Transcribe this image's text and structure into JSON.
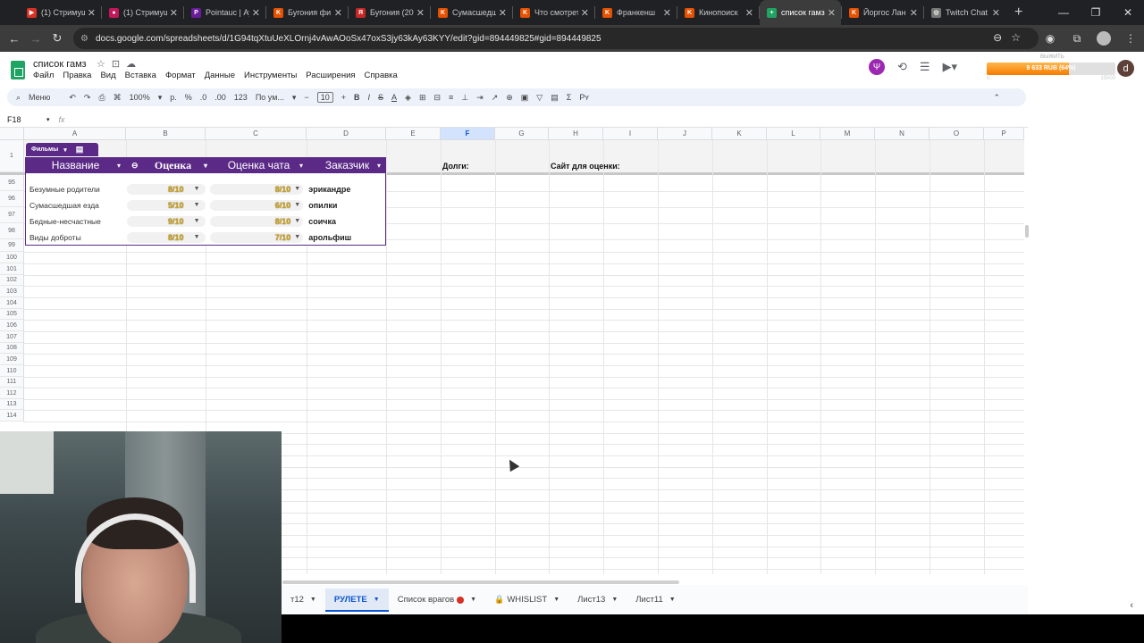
{
  "browser": {
    "tabs": [
      {
        "title": "(1) Стримуш",
        "fav_color": "#d93025",
        "fav": "▶",
        "active": false
      },
      {
        "title": "(1) Стримуш",
        "fav_color": "#c2185b",
        "fav": "●",
        "active": false
      },
      {
        "title": "Pointauc | Ау",
        "fav_color": "#6a1b9a",
        "fav": "P",
        "active": false
      },
      {
        "title": "Бугония фи",
        "fav_color": "#e65100",
        "fav": "K",
        "active": false
      },
      {
        "title": "Бугония (20",
        "fav_color": "#c62828",
        "fav": "Я",
        "active": false
      },
      {
        "title": "Сумасшедш",
        "fav_color": "#e65100",
        "fav": "K",
        "active": false
      },
      {
        "title": "Что смотрет",
        "fav_color": "#e65100",
        "fav": "K",
        "active": false
      },
      {
        "title": "Франкенш",
        "fav_color": "#e65100",
        "fav": "K",
        "active": false
      },
      {
        "title": "Кинопоиск",
        "fav_color": "#e65100",
        "fav": "K",
        "active": false
      },
      {
        "title": "список гамз",
        "fav_color": "#1fa463",
        "fav": "+",
        "active": true
      },
      {
        "title": "Йоргос Лан",
        "fav_color": "#e65100",
        "fav": "K",
        "active": false
      },
      {
        "title": "Twitch Chat",
        "fav_color": "#777777",
        "fav": "◎",
        "active": false
      }
    ],
    "url": "docs.google.com/spreadsheets/d/1G94tqXtuUeXLOrnj4vAwAOoSx47oxS3jy63kAy63KYY/edit?gid=894449825#gid=894449825"
  },
  "sheets": {
    "title": "список гамз",
    "menus": [
      "Файл",
      "Правка",
      "Вид",
      "Вставка",
      "Формат",
      "Данные",
      "Инструменты",
      "Расширения",
      "Справка"
    ],
    "toolbar": {
      "search": "Меню",
      "zoom": "100%",
      "currency": "р.",
      "percent": "%",
      "dec_less": ".0",
      "dec_more": ".00",
      "number_format": "123",
      "font": "По ум...",
      "font_size": "10"
    },
    "name_box": "F18",
    "fx": "fx",
    "columns": [
      "A",
      "B",
      "C",
      "D",
      "E",
      "F",
      "G",
      "H",
      "I",
      "J",
      "K",
      "L",
      "M",
      "N",
      "O",
      "P"
    ],
    "selected_column": "F",
    "row1_label": "1",
    "rows_visible": [
      "95",
      "96",
      "97",
      "98",
      "99",
      "100",
      "101",
      "102",
      "103",
      "104",
      "105",
      "106",
      "107",
      "108",
      "109",
      "110",
      "111",
      "112",
      "113",
      "114"
    ],
    "labels": {
      "debts": "Долги:",
      "rating_site": "Сайт для оценки:"
    },
    "table": {
      "name": "Фильмы",
      "headers": [
        "Название",
        "Оценка",
        "Оценка чата",
        "Заказчик"
      ],
      "rows": [
        {
          "name": "Безумные родители",
          "score": "8/10",
          "chat": "8/10",
          "customer": "эрикандре"
        },
        {
          "name": "Сумасшедшая езда",
          "score": "5/10",
          "chat": "6/10",
          "customer": "опилки"
        },
        {
          "name": "Бедные-несчастные",
          "score": "9/10",
          "chat": "8/10",
          "customer": "соичка"
        },
        {
          "name": "Виды доброты",
          "score": "8/10",
          "chat": "7/10",
          "customer": "арольфиш"
        }
      ]
    },
    "sheet_tabs": [
      {
        "label": "т12",
        "active": false
      },
      {
        "label": "РУЛЕТЕ",
        "active": true
      },
      {
        "label": "Список врагов",
        "active": false,
        "badge": true
      },
      {
        "label": "WHISLIST",
        "active": false,
        "locked": true
      },
      {
        "label": "Лист13",
        "active": false
      },
      {
        "label": "Лист11",
        "active": false
      }
    ]
  },
  "donation": {
    "title": "ВЫЖИТЬ",
    "amount": "9 633 RUB (64%)",
    "progress": 0.64,
    "left_label": "0",
    "right_label": "15000"
  },
  "user_initial": "d"
}
